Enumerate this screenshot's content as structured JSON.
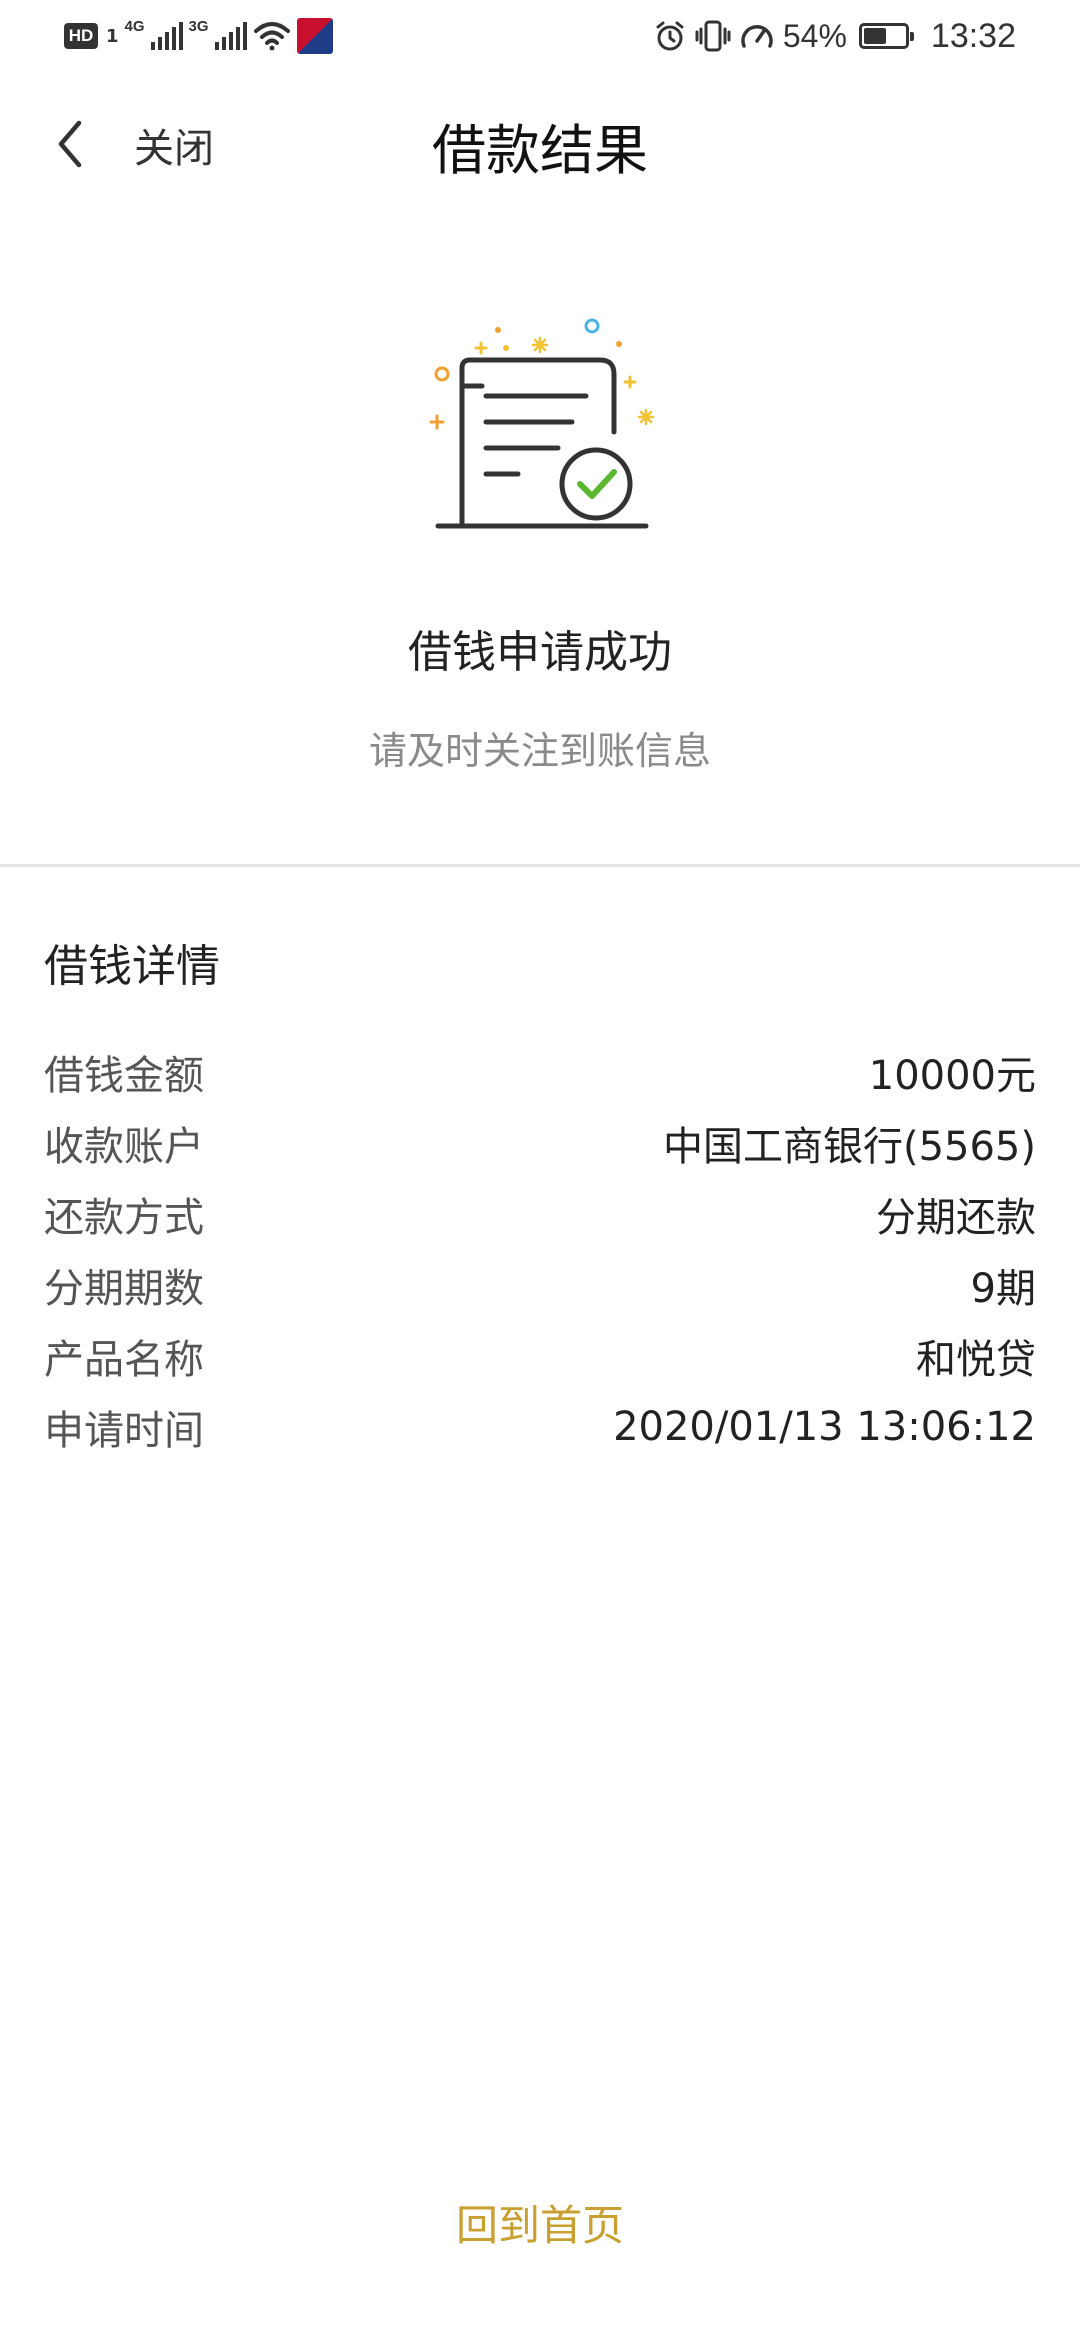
{
  "status_bar": {
    "hd_label": "HD",
    "sim_label": "1",
    "net1_label": "4G",
    "net2_label": "3G",
    "battery_text": "54%",
    "battery_level": 0.54,
    "time": "13:32"
  },
  "nav": {
    "close_label": "关闭",
    "title": "借款结果"
  },
  "result": {
    "title": "借钱申请成功",
    "subtitle": "请及时关注到账信息"
  },
  "details": {
    "title": "借钱详情",
    "rows": [
      {
        "label": "借钱金额",
        "value": "10000元"
      },
      {
        "label": "收款账户",
        "value": "中国工商银行(5565)"
      },
      {
        "label": "还款方式",
        "value": "分期还款"
      },
      {
        "label": "分期期数",
        "value": "9期"
      },
      {
        "label": "产品名称",
        "value": "和悦贷"
      },
      {
        "label": "申请时间",
        "value": "2020/01/13 13:06:12"
      }
    ]
  },
  "bottom": {
    "home_label": "回到首页"
  },
  "colors": {
    "accent": "#c9a030",
    "check_green": "#5bb82e",
    "confetti_yellow": "#f2c233",
    "confetti_blue": "#4ab3e6",
    "confetti_orange": "#f0a030"
  }
}
